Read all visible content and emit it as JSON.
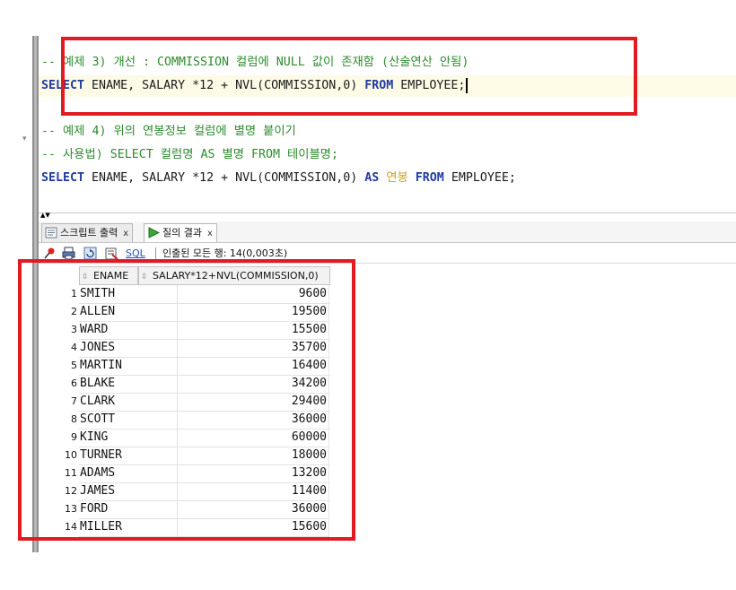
{
  "editor": {
    "lines": [
      {
        "parts": [
          {
            "cls": "comment",
            "t": "-- 예제 3) 개선 : COMMISSION 컬럼에 NULL 값이 존재함 (산술연산 안됨)"
          }
        ]
      },
      {
        "parts": [
          {
            "cls": "kw",
            "t": "SELECT"
          },
          {
            "cls": "txt",
            "t": " ENAME, SALARY *12 + NVL(COMMISSION,0) "
          },
          {
            "cls": "kw",
            "t": "FROM"
          },
          {
            "cls": "txt",
            "t": " EMPLOYEE;"
          }
        ]
      },
      {
        "parts": [
          {
            "cls": "comment",
            "t": "-- 예제 4) 위의 연봉정보 컬럼에 별명 붙이기"
          }
        ]
      },
      {
        "parts": [
          {
            "cls": "comment",
            "t": "-- 사용법) SELECT 컬럼명 AS 별명 FROM 테이블명;"
          }
        ]
      },
      {
        "parts": [
          {
            "cls": "kw",
            "t": "SELECT"
          },
          {
            "cls": "txt",
            "t": " ENAME, SALARY *12 + NVL(COMMISSION,0) "
          },
          {
            "cls": "kw",
            "t": "AS"
          },
          {
            "cls": "txt",
            "t": " "
          },
          {
            "cls": "alias-ko",
            "t": "연봉"
          },
          {
            "cls": "txt",
            "t": " "
          },
          {
            "cls": "kw",
            "t": "FROM"
          },
          {
            "cls": "txt",
            "t": " EMPLOYEE;"
          }
        ]
      }
    ]
  },
  "tabs": [
    {
      "label": "스크립트 출력",
      "close": "x",
      "icon": "script-output-icon"
    },
    {
      "label": "질의 결과",
      "close": "x",
      "icon": "query-result-icon"
    }
  ],
  "toolbar": {
    "sql_label": "SQL",
    "status": "인출된 모든 행: 14(0,003초)"
  },
  "grid": {
    "columns": [
      "ENAME",
      "SALARY*12+NVL(COMMISSION,0)"
    ],
    "rows": [
      {
        "n": "1",
        "ename": "SMITH",
        "salary": "9600"
      },
      {
        "n": "2",
        "ename": "ALLEN",
        "salary": "19500"
      },
      {
        "n": "3",
        "ename": "WARD",
        "salary": "15500"
      },
      {
        "n": "4",
        "ename": "JONES",
        "salary": "35700"
      },
      {
        "n": "5",
        "ename": "MARTIN",
        "salary": "16400"
      },
      {
        "n": "6",
        "ename": "BLAKE",
        "salary": "34200"
      },
      {
        "n": "7",
        "ename": "CLARK",
        "salary": "29400"
      },
      {
        "n": "8",
        "ename": "SCOTT",
        "salary": "36000"
      },
      {
        "n": "9",
        "ename": "KING",
        "salary": "60000"
      },
      {
        "n": "10",
        "ename": "TURNER",
        "salary": "18000"
      },
      {
        "n": "11",
        "ename": "ADAMS",
        "salary": "13200"
      },
      {
        "n": "12",
        "ename": "JAMES",
        "salary": "11400"
      },
      {
        "n": "13",
        "ename": "FORD",
        "salary": "36000"
      },
      {
        "n": "14",
        "ename": "MILLER",
        "salary": "15600"
      }
    ]
  },
  "colors": {
    "highlight_box": "#e21b23",
    "comment": "#2e8b2e",
    "keyword": "#1f3aa0",
    "alias": "#d4a017"
  }
}
